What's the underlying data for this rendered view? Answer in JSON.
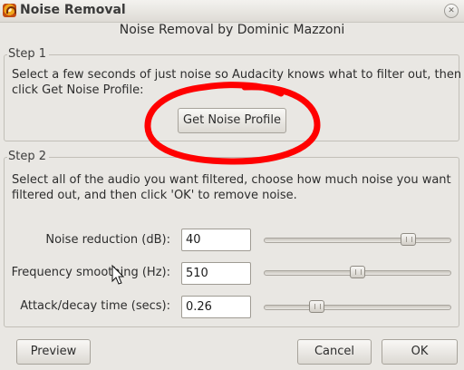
{
  "window": {
    "title": "Noise Removal",
    "close_glyph": "✕",
    "icon": "audacity-app-icon"
  },
  "header": {
    "text": "Noise Removal by Dominic Mazzoni"
  },
  "step1": {
    "legend": "Step 1",
    "instructions": "Select a few seconds of just noise so Audacity knows what to filter out, then click Get Noise Profile:",
    "button_label": "Get Noise Profile"
  },
  "step2": {
    "legend": "Step 2",
    "instructions": "Select all of the audio you want filtered, choose how much noise you want filtered out, and then click 'OK' to remove noise.",
    "params": [
      {
        "label": "Noise reduction (dB):",
        "value": "40",
        "slider_fraction": 0.8
      },
      {
        "label": "Frequency smoothing (Hz):",
        "value": "510",
        "slider_fraction": 0.5
      },
      {
        "label": "Attack/decay time (secs):",
        "value": "0.26",
        "slider_fraction": 0.26
      }
    ]
  },
  "buttons": {
    "preview": "Preview",
    "cancel": "Cancel",
    "ok": "OK"
  },
  "annotation": {
    "color": "#ff0000"
  }
}
